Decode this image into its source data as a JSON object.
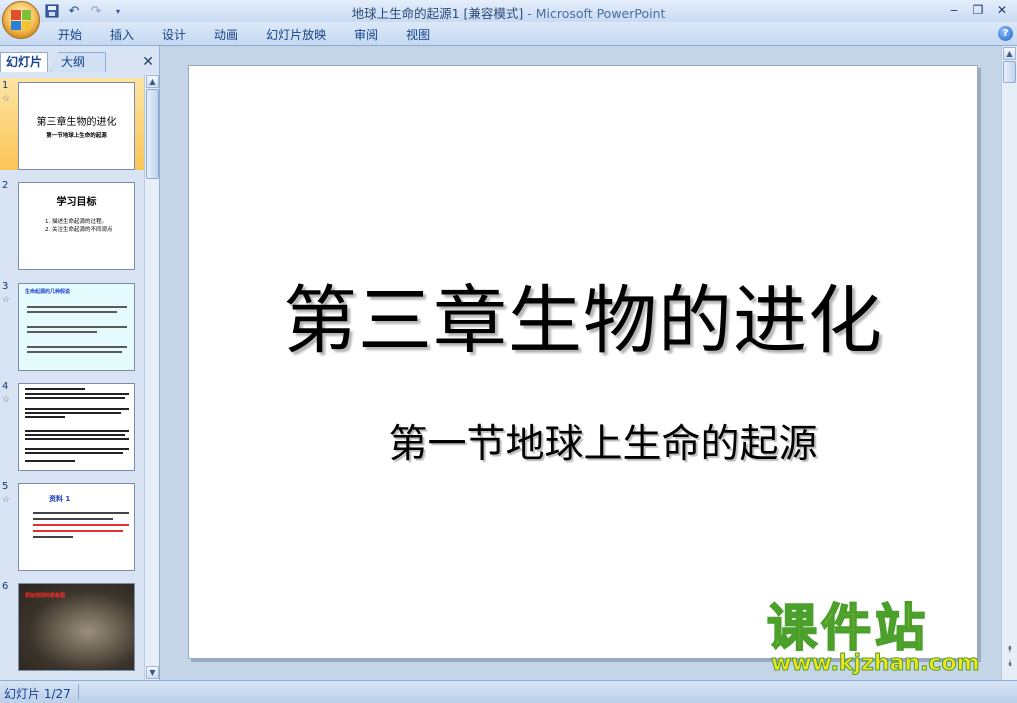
{
  "window": {
    "title_doc": "地球上生命的起源1 [兼容模式]",
    "title_sep": " - ",
    "title_app": "Microsoft PowerPoint"
  },
  "ribbon": {
    "tabs": [
      "开始",
      "插入",
      "设计",
      "动画",
      "幻灯片放映",
      "审阅",
      "视图"
    ]
  },
  "left_pane": {
    "tab_slides": "幻灯片",
    "tab_outline": "大纲"
  },
  "thumbnails": {
    "s1": {
      "num": "1",
      "title": "第三章生物的进化",
      "subtitle": "第一节地球上生命的起源"
    },
    "s2": {
      "num": "2",
      "title": "学习目标",
      "line1": "1. 描述生命起源的过程。",
      "line2": "2. 关注生命起源的不同观点"
    },
    "s3": {
      "num": "3",
      "title": "生命起源的几种假说"
    },
    "s4": {
      "num": "4"
    },
    "s5": {
      "num": "5",
      "title": "资料 1"
    },
    "s6": {
      "num": "6",
      "title": "原始地球的想象图"
    }
  },
  "slide": {
    "title": "第三章生物的进化",
    "subtitle": "第一节地球上生命的起源"
  },
  "watermark": {
    "brand": "课件站",
    "url": "www.kjzhan.com"
  },
  "status": {
    "slide_counter": "幻灯片 1/27"
  }
}
